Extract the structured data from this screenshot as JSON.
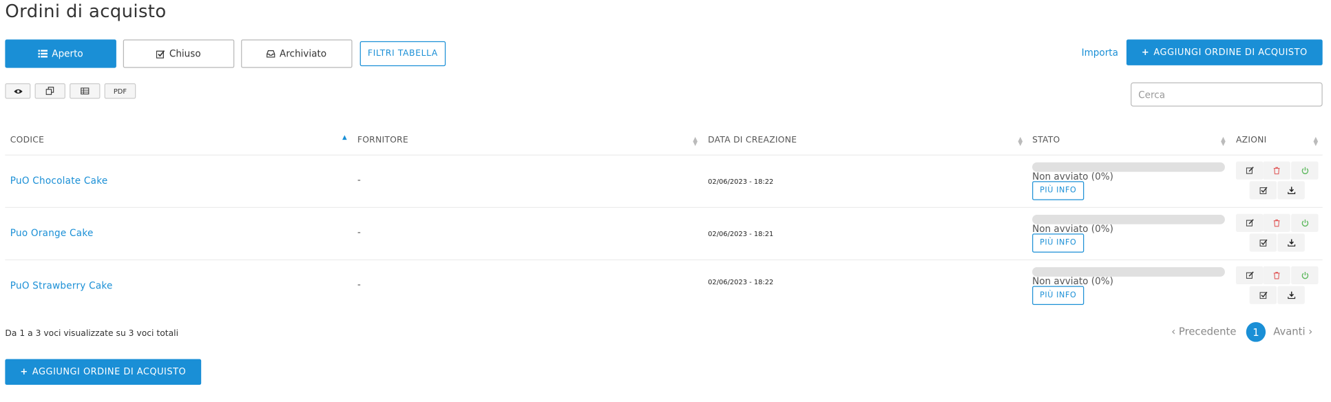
{
  "page": {
    "title": "Ordini di acquisto"
  },
  "tabs": [
    {
      "label": "Aperto",
      "icon": "list-icon",
      "active": true
    },
    {
      "label": "Chiuso",
      "icon": "check-square-icon",
      "active": false
    },
    {
      "label": "Archiviato",
      "icon": "inbox-icon",
      "active": false
    }
  ],
  "toolbar": {
    "filters_label": "FILTRI TABELLA",
    "import_label": "Importa",
    "add_label": "AGGIUNGI ORDINE DI ACQUISTO",
    "pdf_label": "PDF",
    "tools": [
      "eye-icon",
      "copy-icon",
      "table-icon",
      "pdf"
    ]
  },
  "search": {
    "placeholder": "Cerca",
    "value": ""
  },
  "table": {
    "columns": [
      "CODICE",
      "FORNITORE",
      "DATA DI CREAZIONE",
      "STATO",
      "AZIONI"
    ],
    "rows": [
      {
        "code": "PuO Chocolate Cake",
        "supplier": "-",
        "date": "02/06/2023 - 18:22",
        "status": "Non avviato (0%)",
        "progress": 0,
        "more": "PIÙ INFO"
      },
      {
        "code": "Puo Orange Cake",
        "supplier": "-",
        "date": "02/06/2023 - 18:21",
        "status": "Non avviato (0%)",
        "progress": 0,
        "more": "PIÙ INFO"
      },
      {
        "code": "PuO Strawberry Cake",
        "supplier": "-",
        "date": "02/06/2023 - 18:22",
        "status": "Non avviato (0%)",
        "progress": 0,
        "more": "PIÙ INFO"
      }
    ]
  },
  "footer": {
    "info": "Da 1 a 3 voci visualizzate su 3 voci totali",
    "prev": "Precedente",
    "next": "Avanti",
    "current_page": "1",
    "add_label": "AGGIUNGI ORDINE DI ACQUISTO"
  },
  "colors": {
    "accent": "#1a8fd6",
    "delete": "#e05a5a",
    "power": "#5cb85c"
  }
}
